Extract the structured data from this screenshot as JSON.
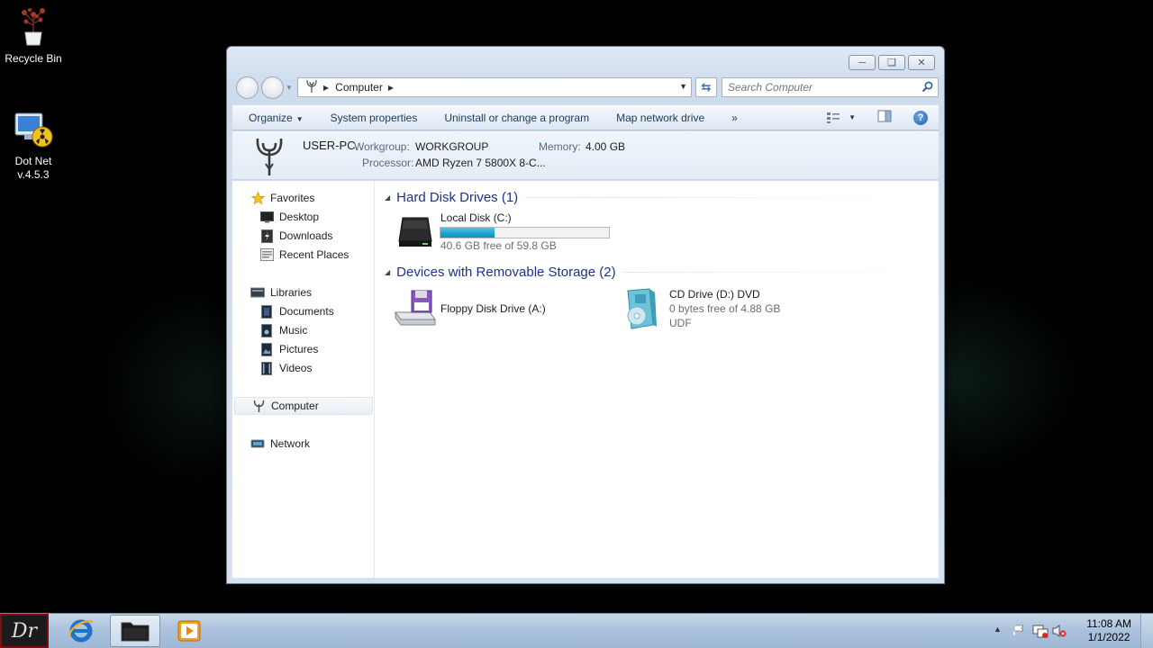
{
  "desktop": {
    "icons": [
      {
        "label": "Recycle Bin",
        "icon": "recycle-bin-icon"
      },
      {
        "label": "Dot Net\nv.4.5.3",
        "label_line1": "Dot Net",
        "label_line2": "v.4.5.3",
        "icon": "dotnet-installer-icon"
      }
    ]
  },
  "window": {
    "address": {
      "root_icon": "computer-icon",
      "crumb": "Computer"
    },
    "search": {
      "placeholder": "Search Computer"
    },
    "commands": {
      "organize": "Organize",
      "system_properties": "System properties",
      "uninstall": "Uninstall or change a program",
      "map_drive": "Map network drive",
      "more": "»"
    },
    "details": {
      "computer_name": "USER-PC",
      "workgroup_label": "Workgroup:",
      "workgroup_value": "WORKGROUP",
      "memory_label": "Memory:",
      "memory_value": "4.00 GB",
      "processor_label": "Processor:",
      "processor_value": "AMD Ryzen 7 5800X 8-C..."
    },
    "nav": {
      "favorites": "Favorites",
      "desktop": "Desktop",
      "downloads": "Downloads",
      "recent_places": "Recent Places",
      "libraries": "Libraries",
      "documents": "Documents",
      "music": "Music",
      "pictures": "Pictures",
      "videos": "Videos",
      "computer": "Computer",
      "network": "Network"
    },
    "groups": {
      "hdd": "Hard Disk Drives (1)",
      "removable": "Devices with Removable Storage (2)"
    },
    "drives": {
      "c": {
        "name": "Local Disk (C:)",
        "free_text": "40.6 GB free of 59.8 GB",
        "used_fraction": 0.32
      },
      "a": {
        "name": "Floppy Disk Drive (A:)"
      },
      "d": {
        "name": "CD Drive (D:) DVD",
        "free_text": "0 bytes free of 4.88 GB",
        "fs": "UDF"
      }
    }
  },
  "taskbar": {
    "start_label": "Dr",
    "clock_time": "11:08 AM",
    "clock_date": "1/1/2022"
  }
}
